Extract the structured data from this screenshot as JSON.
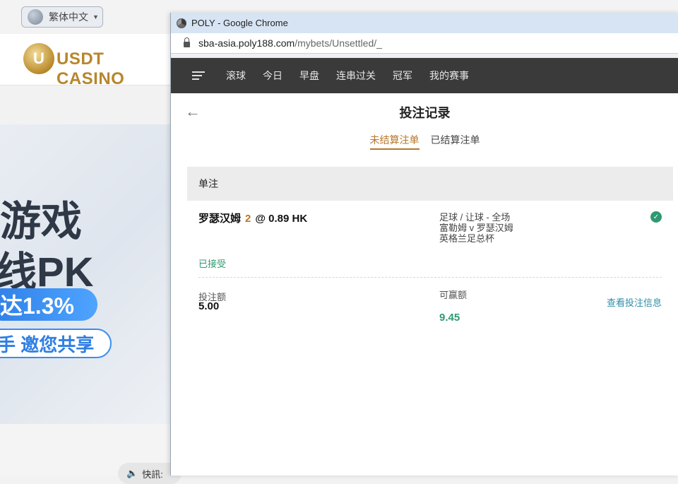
{
  "background": {
    "language": "繁体中文",
    "logo_letter": "U",
    "logo_text": "USDT CASINO",
    "banner_line1": "游戏",
    "banner_line2": "线PK",
    "banner_pill1": "达1.3%",
    "banner_pill2": "手 邀您共享",
    "notice_text": "快訊:"
  },
  "window": {
    "title": "POLY - Google Chrome",
    "url_host": "sba-asia.poly188.com",
    "url_path": "/mybets/Unsettled/_"
  },
  "nav": {
    "items": [
      "滚球",
      "今日",
      "早盘",
      "连串过关",
      "冠军",
      "我的赛事"
    ]
  },
  "page": {
    "back_glyph": "←",
    "title": "投注记录",
    "tabs": [
      "未结算注单",
      "已结算注单"
    ],
    "active_tab": 0
  },
  "section": {
    "title": "单注"
  },
  "bet": {
    "team": "罗瑟汉姆",
    "handicap": "2",
    "at": "@",
    "odds": "0.89 HK",
    "market": "足球 / 让球 - 全场",
    "match": "富勒姆 v 罗瑟汉姆",
    "league": "英格兰足总杯",
    "status": "已接受",
    "stake_label": "投注额",
    "stake": "5.00",
    "win_label": "可赢额",
    "win": "9.45",
    "details_link": "查看投注信息"
  },
  "colors": {
    "accent": "#b7762a",
    "success": "#2f9a72",
    "nav_bg": "#3a3a3a",
    "link": "#2f8fa8"
  }
}
